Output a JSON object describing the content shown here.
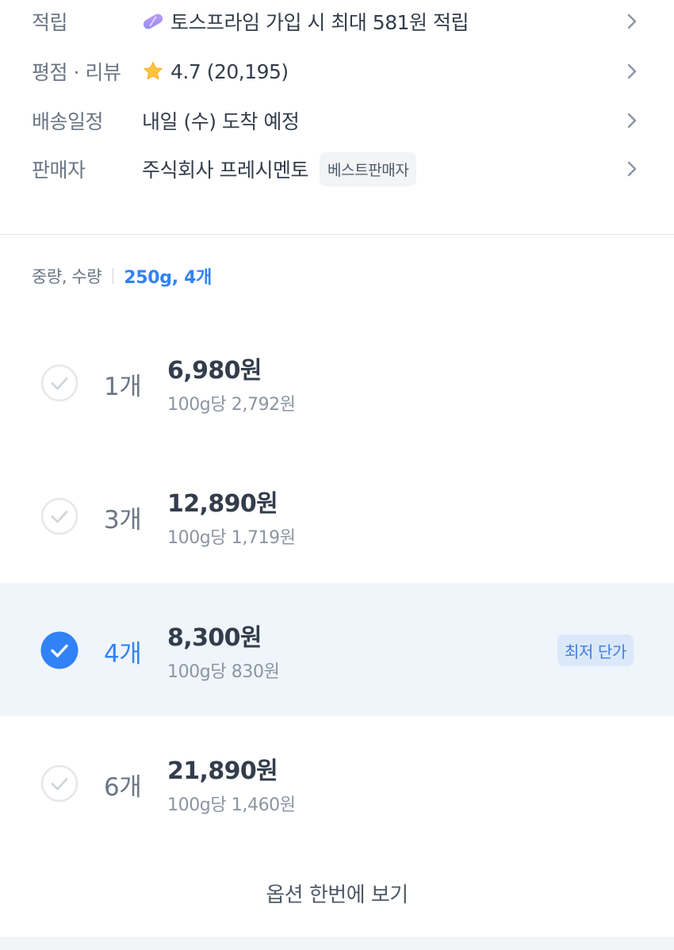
{
  "info": {
    "rows": [
      {
        "label": "적립",
        "value": "토스프라임 가입 시 최대 581원 적립",
        "icon": "toss-prime-icon"
      },
      {
        "label": "평점 · 리뷰",
        "value": "4.7 (20,195)",
        "icon": "star-icon"
      },
      {
        "label": "배송일정",
        "value": "내일 (수) 도착 예정"
      },
      {
        "label": "판매자",
        "value": "주식회사 프레시멘토",
        "badge": "베스트판매자"
      }
    ]
  },
  "options": {
    "header_label": "중량, 수량",
    "header_value": "250g, 4개",
    "items": [
      {
        "qty": "1개",
        "price": "6,980원",
        "unit_price": "100g당 2,792원",
        "selected": false
      },
      {
        "qty": "3개",
        "price": "12,890원",
        "unit_price": "100g당 1,719원",
        "selected": false
      },
      {
        "qty": "4개",
        "price": "8,300원",
        "unit_price": "100g당 830원",
        "selected": true,
        "badge": "최저 단가"
      },
      {
        "qty": "6개",
        "price": "21,890원",
        "unit_price": "100g당 1,460원",
        "selected": false
      }
    ],
    "view_all_label": "옵션 한번에 보기"
  },
  "colors": {
    "accent": "#3182f6",
    "selected_bg": "#f0f5fc",
    "star": "#ffc342",
    "badge_bg": "#dbe8fa"
  }
}
